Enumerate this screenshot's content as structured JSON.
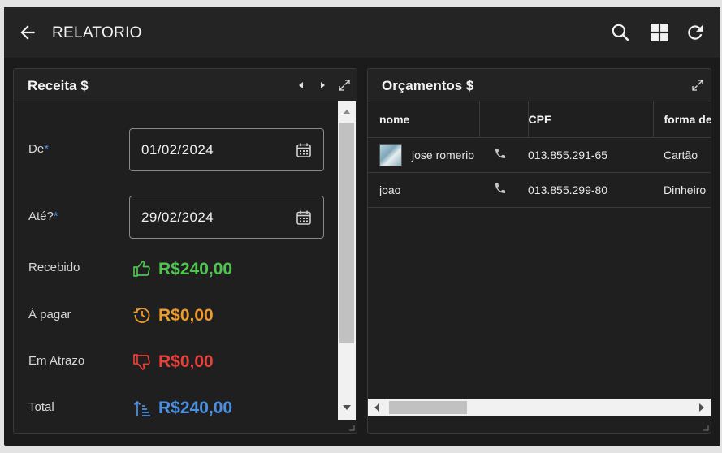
{
  "appbar": {
    "title": "RELATORIO",
    "icons": [
      "arrow-back-icon",
      "search-icon",
      "dashboard-grid-icon",
      "refresh-icon"
    ]
  },
  "receita": {
    "title": "Receita $",
    "from_label": "De",
    "from_value": "01/02/2024",
    "to_label": "Até?",
    "to_value": "29/02/2024",
    "required_mark": "*",
    "stats": [
      {
        "label": "Recebido",
        "value": "R$240,00",
        "color": "#4fc44f",
        "icon": "thumbs-up-icon"
      },
      {
        "label": "Á pagar",
        "value": "R$0,00",
        "color": "#ef9a2a",
        "icon": "history-icon"
      },
      {
        "label": "Em Atrazo",
        "value": "R$0,00",
        "color": "#e8403a",
        "icon": "thumbs-down-icon"
      },
      {
        "label": "Total",
        "value": "R$240,00",
        "color": "#4a8fe0",
        "icon": "sort-ascending-icon"
      }
    ]
  },
  "orcamentos": {
    "title": "Orçamentos $",
    "columns": [
      "nome",
      "",
      "CPF",
      "forma de p"
    ],
    "rows": [
      {
        "nome": "jose romerio",
        "has_avatar": true,
        "cpf": "013.855.291-65",
        "forma": "Cartão"
      },
      {
        "nome": "joao",
        "has_avatar": false,
        "cpf": "013.855.299-80",
        "forma": "Dinheiro"
      }
    ]
  }
}
